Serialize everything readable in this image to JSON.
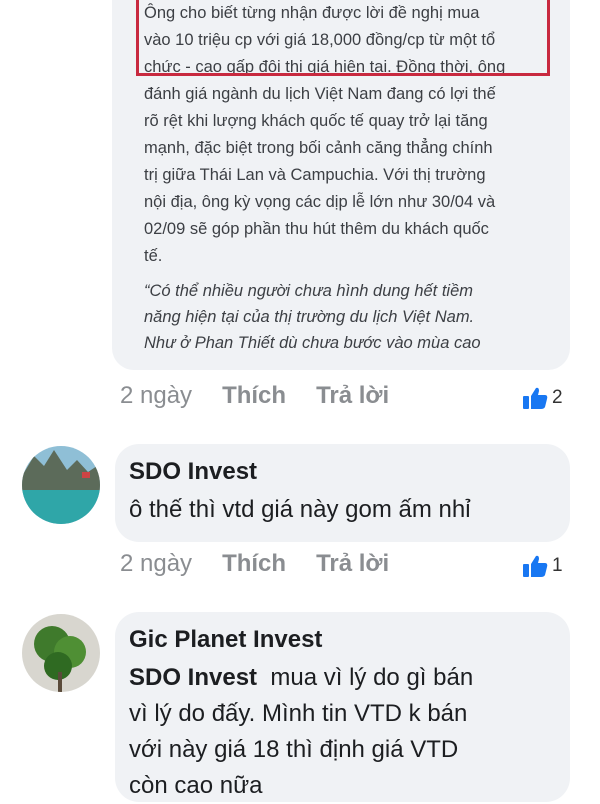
{
  "post": {
    "paragraph_lines": [
      "Ông cho biết từng nhận được lời đề nghị mua",
      "vào 10 triệu cp với giá 18,000 đồng/cp từ một tổ",
      "chức - cao gấp đôi thị giá hiện tại. Đồng thời, ông",
      "đánh giá ngành du lịch Việt Nam đang có lợi thế",
      "rõ rệt khi lượng khách quốc tế quay trở lại tăng",
      "mạnh, đặc biệt trong bối cảnh căng thẳng chính",
      "trị giữa Thái Lan và Campuchia. Với thị trường",
      "nội địa, ông kỳ vọng các dịp lễ lớn như 30/04 và",
      "02/09 sẽ góp phần thu hút thêm du khách quốc",
      "tế."
    ],
    "quote_lines": [
      "“Có thể nhiều người chưa hình dung hết tiềm",
      "năng hiện tại của thị trường du lịch Việt Nam.",
      "Như ở Phan Thiết dù chưa bước vào mùa cao"
    ],
    "time": "2 ngày",
    "like_label": "Thích",
    "reply_label": "Trả lời",
    "reaction_count": "2"
  },
  "comments": [
    {
      "author": "SDO Invest",
      "text": "ô thế thì vtd giá này gom ấm nhỉ",
      "time": "2 ngày",
      "like_label": "Thích",
      "reply_label": "Trả lời",
      "reaction_count": "1"
    },
    {
      "author": "Gic Planet Invest",
      "mention": "SDO Invest",
      "text_lines": [
        "  mua vì lý do gì bán",
        "vì lý do đấy. Mình tin VTD k bán",
        "với này giá 18 thì định giá VTD",
        "còn cao nữa"
      ]
    }
  ],
  "colors": {
    "bubble": "#f0f2f5",
    "highlight_border": "#c8293f",
    "like_blue": "#1877f2",
    "meta_gray": "#8a8d91"
  }
}
